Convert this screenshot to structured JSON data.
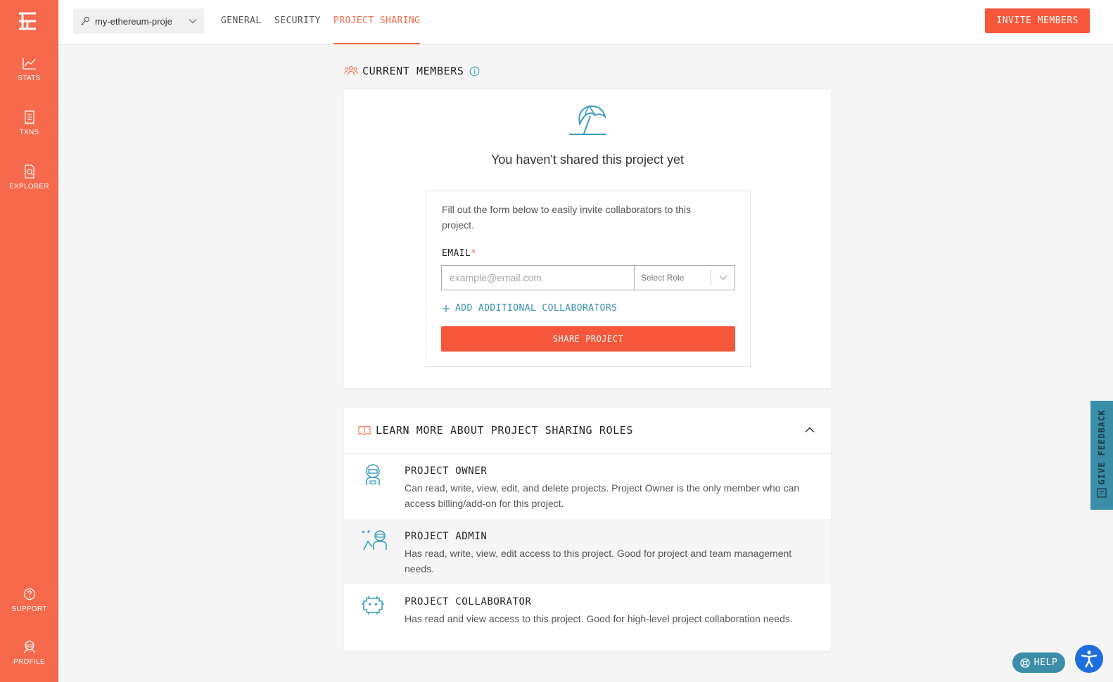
{
  "sidebar": {
    "logo": "tenderly-logo-icon",
    "items": [
      {
        "label": "STATS",
        "icon": "line-chart-icon"
      },
      {
        "label": "TXNS",
        "icon": "receipt-icon"
      },
      {
        "label": "EXPLORER",
        "icon": "search-document-icon"
      }
    ],
    "bottom_items": [
      {
        "label": "SUPPORT",
        "icon": "question-circle-icon"
      },
      {
        "label": "PROFILE",
        "icon": "astronaut-icon"
      }
    ]
  },
  "topbar": {
    "project_name": "my-ethereum-proje",
    "tabs": [
      {
        "label": "GENERAL",
        "active": false
      },
      {
        "label": "SECURITY",
        "active": false
      },
      {
        "label": "PROJECT SHARING",
        "active": true
      }
    ],
    "invite_button": "INVITE MEMBERS"
  },
  "members": {
    "title": "CURRENT MEMBERS",
    "empty_title": "You haven't shared this project yet",
    "form": {
      "description": "Fill out the form below to easily invite collaborators to this project.",
      "email_label": "EMAIL",
      "required_mark": "*",
      "email_placeholder": "example@email.com",
      "role_placeholder": "Select Role",
      "add_link": "ADD ADDITIONAL COLLABORATORS",
      "share_button": "SHARE PROJECT"
    }
  },
  "roles": {
    "title": "LEARN MORE ABOUT PROJECT SHARING ROLES",
    "items": [
      {
        "title": "PROJECT OWNER",
        "description": "Can read, write, view, edit, and delete projects. Project Owner is the only member who can access billing/add-on for this project.",
        "icon": "astronaut-icon"
      },
      {
        "title": "PROJECT ADMIN",
        "description": "Has read, write, view, edit access to this project. Good for project and team management needs.",
        "icon": "admin-astronaut-icon"
      },
      {
        "title": "PROJECT COLLABORATOR",
        "description": "Has read and view access to this project. Good for high-level project collaboration needs.",
        "icon": "space-invader-icon"
      }
    ]
  },
  "floating": {
    "feedback": "GIVE FEEDBACK",
    "help": "HELP"
  },
  "colors": {
    "brand": "#f6694b",
    "button": "#f6573a",
    "accent_teal": "#3b8ea7",
    "a11y_blue": "#1e6ee0"
  }
}
